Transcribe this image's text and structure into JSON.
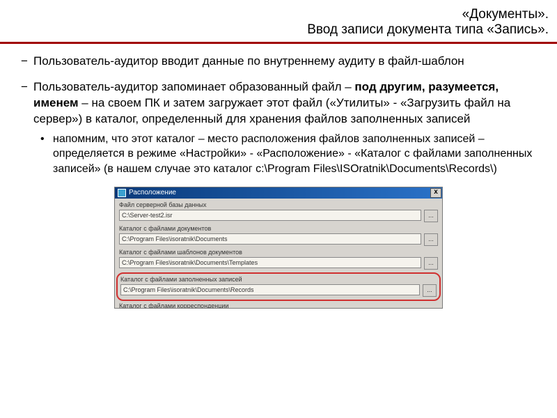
{
  "header": {
    "line1": "«Документы».",
    "line2": "Ввод записи документа типа «Запись»."
  },
  "bullets": {
    "item1": "Пользователь-аудитор вводит данные по внутреннему аудиту в файл-шаблон",
    "item2_pre": "Пользователь-аудитор запоминает образованный файл – ",
    "item2_bold": "под другим, разумеется, именем",
    "item2_post": " – на своем ПК и затем загружает этот файл («Утилиты» - «Загрузить файл на сервер») в каталог, определенный для хранения файлов заполненных записей",
    "sub1": "напомним, что этот каталог – место расположения файлов заполненных записей – определяется в режиме «Настройки» - «Расположение» - «Каталог с файлами заполненных записей» (в нашем случае это каталог c:\\Program Files\\ISOratnik\\Documents\\Records\\)"
  },
  "dialog": {
    "title": "Расположение",
    "close": "x",
    "browse": "...",
    "g1_label": "Файл серверной базы данных",
    "g1_value": "C:\\Server-test2.isr",
    "g2_label": "Каталог с файлами документов",
    "g2_value": "C:\\Program Files\\isoratnik\\Documents",
    "g3_label": "Каталог с файлами шаблонов документов",
    "g3_value": "C:\\Program Files\\isoratnik\\Documents\\Templates",
    "g4_label": "Каталог с файлами заполненных записей",
    "g4_value": "C:\\Program Files\\isoratnik\\Documents\\Records",
    "g5_label": "Каталог с файлами корреспонденции"
  }
}
